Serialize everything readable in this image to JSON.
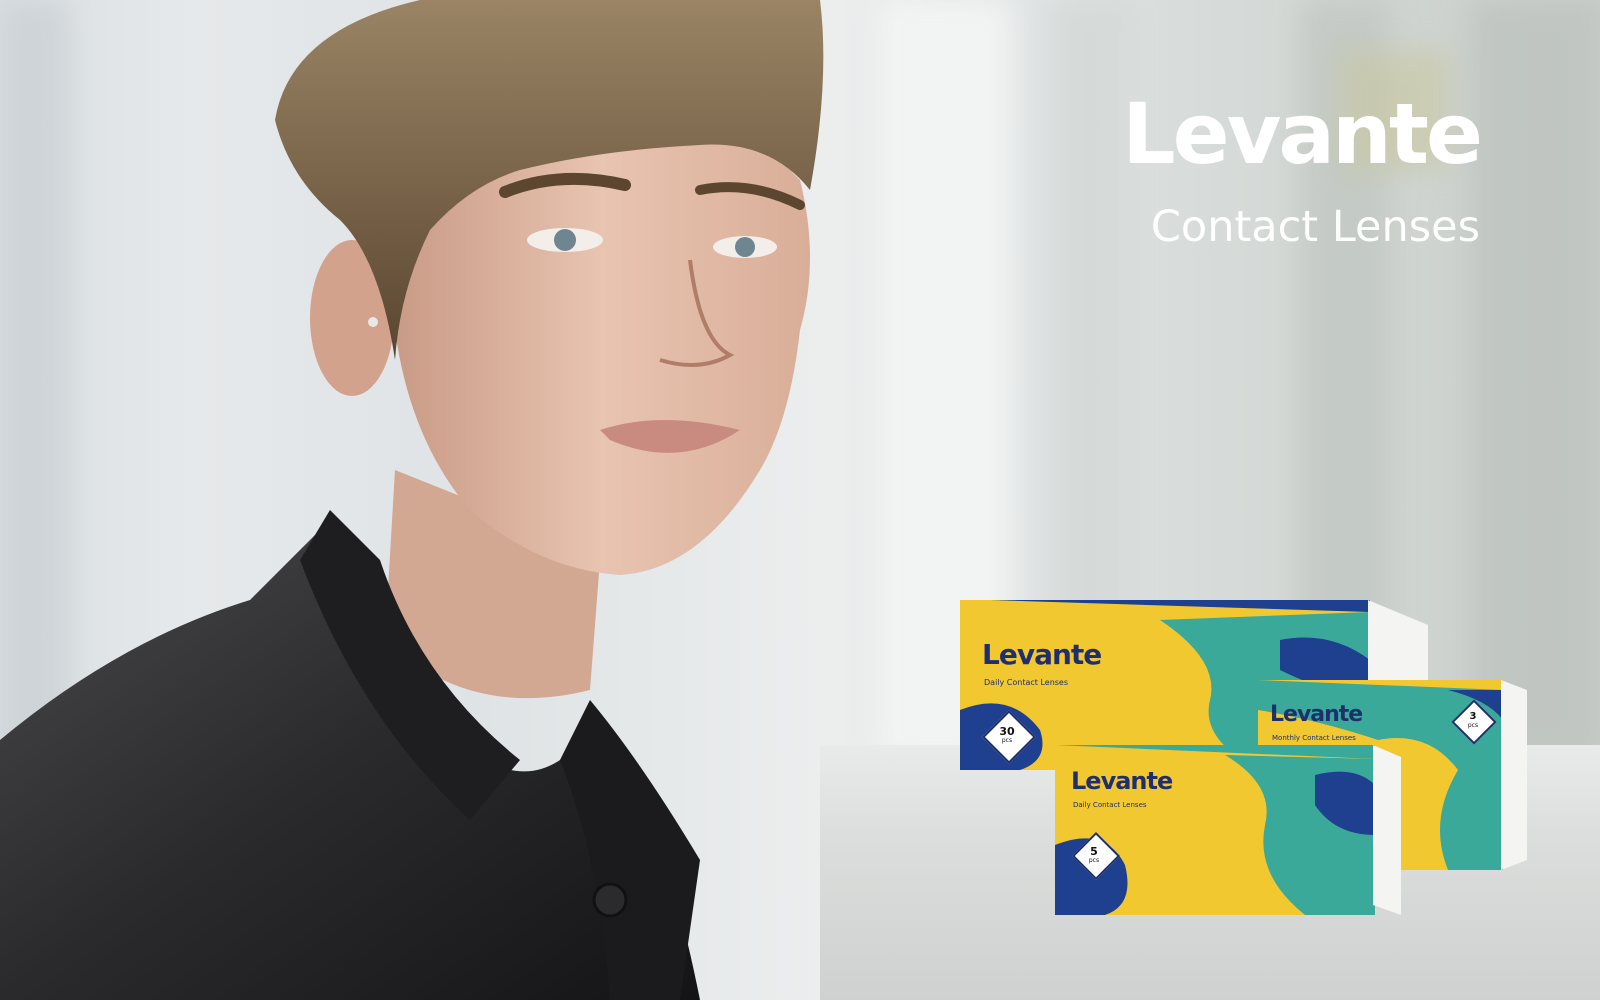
{
  "brand": {
    "title": "Levante",
    "subtitle": "Contact Lenses"
  },
  "colors": {
    "yellow": "#f2c830",
    "teal": "#3aa99a",
    "navy": "#1f3f8f",
    "brand_text": "#1f2f6e",
    "headline": "#ffffff"
  },
  "products": [
    {
      "name": "Levante",
      "type": "Daily Contact Lenses",
      "count": "30",
      "unit": "pcs"
    },
    {
      "name": "Levante",
      "type": "Monthly Contact Lenses",
      "count": "3",
      "unit": "pcs"
    },
    {
      "name": "Levante",
      "type": "Daily Contact Lenses",
      "count": "5",
      "unit": "pcs"
    }
  ]
}
